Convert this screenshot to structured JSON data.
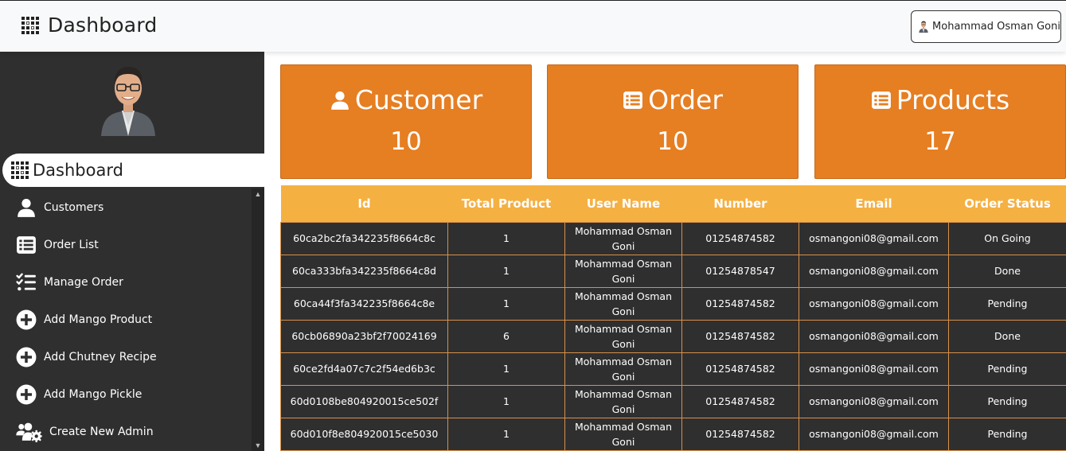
{
  "header": {
    "title": "Dashboard",
    "user_name": "Mohammad Osman Goni"
  },
  "sidebar": {
    "active_label": "Dashboard",
    "items": [
      {
        "label": "Customers",
        "icon": "user-icon"
      },
      {
        "label": "Order List",
        "icon": "list-icon"
      },
      {
        "label": "Manage Order",
        "icon": "tasks-icon"
      },
      {
        "label": "Add Mango Product",
        "icon": "plus-circle-icon"
      },
      {
        "label": "Add Chutney Recipe",
        "icon": "plus-circle-icon"
      },
      {
        "label": "Add Mango Pickle",
        "icon": "plus-circle-icon"
      },
      {
        "label": "Create New Admin",
        "icon": "users-cog-icon"
      }
    ]
  },
  "cards": [
    {
      "title": "Customer",
      "value": "10",
      "icon": "user-icon"
    },
    {
      "title": "Order",
      "value": "10",
      "icon": "list-icon"
    },
    {
      "title": "Products",
      "value": "17",
      "icon": "list-icon"
    }
  ],
  "table": {
    "headers": [
      "Id",
      "Total Product",
      "User Name",
      "Number",
      "Email",
      "Order Status"
    ],
    "rows": [
      [
        "60ca2bc2fa342235f8664c8c",
        "1",
        "Mohammad Osman Goni",
        "01254874582",
        "osmangoni08@gmail.com",
        "On Going"
      ],
      [
        "60ca333bfa342235f8664c8d",
        "1",
        "Mohammad Osman Goni",
        "01254878547",
        "osmangoni08@gmail.com",
        "Done"
      ],
      [
        "60ca44f3fa342235f8664c8e",
        "1",
        "Mohammad Osman Goni",
        "01254874582",
        "osmangoni08@gmail.com",
        "Pending"
      ],
      [
        "60cb06890a23bf2f70024169",
        "6",
        "Mohammad Osman Goni",
        "01254874582",
        "osmangoni08@gmail.com",
        "Done"
      ],
      [
        "60ce2fd4a07c7c2f54ed6b3c",
        "1",
        "Mohammad Osman Goni",
        "01254874582",
        "osmangoni08@gmail.com",
        "Pending"
      ],
      [
        "60d0108be804920015ce502f",
        "1",
        "Mohammad Osman Goni",
        "01254874582",
        "osmangoni08@gmail.com",
        "Pending"
      ],
      [
        "60d010f8e804920015ce5030",
        "1",
        "Mohammad Osman Goni",
        "01254874582",
        "osmangoni08@gmail.com",
        "Pending"
      ]
    ]
  },
  "colors": {
    "card_bg": "#e67e22",
    "table_header_bg": "#f5b042",
    "sidebar_bg": "#2f2f2f"
  }
}
